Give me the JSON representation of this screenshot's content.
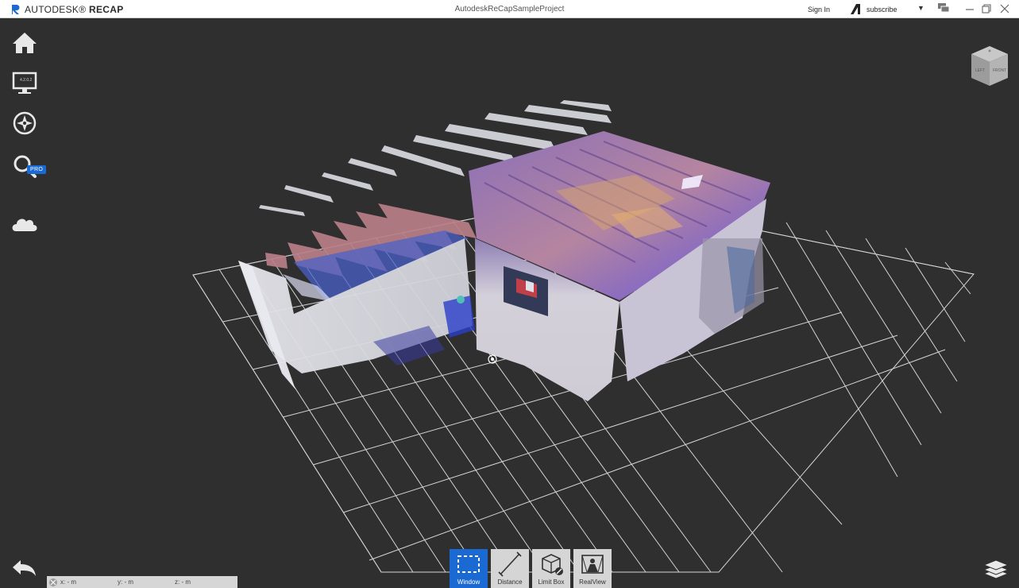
{
  "titlebar": {
    "brand": "AUTODESK",
    "brand_product": "RECAP",
    "window_title": "AutodeskReCapSampleProject",
    "sign_in": "Sign In",
    "account": "subscribe"
  },
  "sidebar": {
    "pro_badge": "PRO",
    "monitor_label": "4.2.0.2",
    "items": [
      {
        "icon": "home-icon"
      },
      {
        "icon": "monitor-icon"
      },
      {
        "icon": "compass-icon"
      },
      {
        "icon": "search-icon"
      },
      {
        "icon": "cloud-icon"
      }
    ]
  },
  "viewcube": {
    "left": "LEFT",
    "front": "FRONT"
  },
  "coordinates": {
    "x": "x:  -  m",
    "y": "y:  -  m",
    "z": "z:  -  m"
  },
  "toolbar": {
    "tools": [
      {
        "label": "Window",
        "active": true
      },
      {
        "label": "Distance",
        "active": false
      },
      {
        "label": "Limit Box",
        "active": false
      },
      {
        "label": "RealView",
        "active": false
      }
    ]
  },
  "colors": {
    "accent": "#1b69d3",
    "background": "#2f2f2f",
    "grid": "#e6e6e6"
  }
}
